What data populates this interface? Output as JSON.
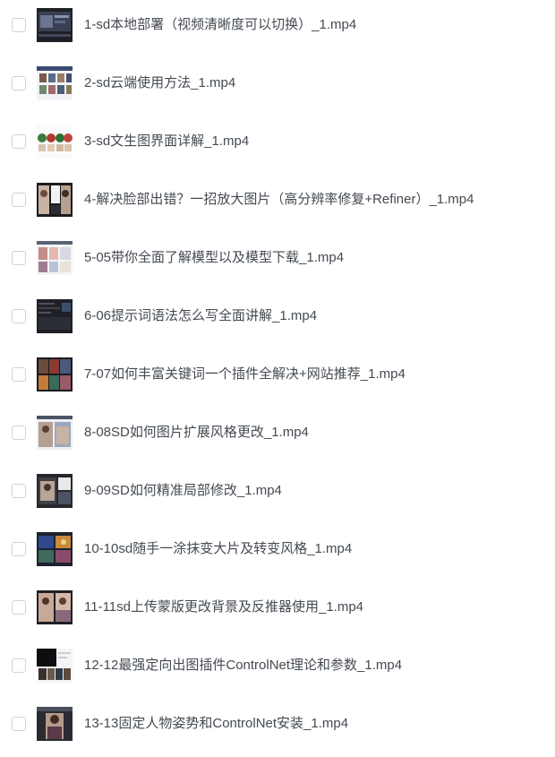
{
  "files": [
    {
      "name": "1-sd本地部署（视频清晰度可以切换）_1.mp4",
      "thumbnail": "video-thumbnail"
    },
    {
      "name": "2-sd云端使用方法_1.mp4",
      "thumbnail": "video-thumbnail"
    },
    {
      "name": "3-sd文生图界面详解_1.mp4",
      "thumbnail": "video-thumbnail"
    },
    {
      "name": "4-解决脸部出错？一招放大图片（高分辨率修复+Refiner）_1.mp4",
      "thumbnail": "video-thumbnail"
    },
    {
      "name": "5-05带你全面了解模型以及模型下载_1.mp4",
      "thumbnail": "video-thumbnail"
    },
    {
      "name": "6-06提示词语法怎么写全面讲解_1.mp4",
      "thumbnail": "video-thumbnail"
    },
    {
      "name": "7-07如何丰富关键词一个插件全解决+网站推荐_1.mp4",
      "thumbnail": "video-thumbnail"
    },
    {
      "name": "8-08SD如何图片扩展风格更改_1.mp4",
      "thumbnail": "video-thumbnail"
    },
    {
      "name": "9-09SD如何精准局部修改_1.mp4",
      "thumbnail": "video-thumbnail"
    },
    {
      "name": "10-10sd随手一涂抹变大片及转变风格_1.mp4",
      "thumbnail": "video-thumbnail"
    },
    {
      "name": "11-11sd上传蒙版更改背景及反推器使用_1.mp4",
      "thumbnail": "video-thumbnail"
    },
    {
      "name": "12-12最强定向出图插件ControlNet理论和参数_1.mp4",
      "thumbnail": "video-thumbnail"
    },
    {
      "name": "13-13固定人物姿势和ControlNet安装_1.mp4",
      "thumbnail": "video-thumbnail"
    }
  ]
}
